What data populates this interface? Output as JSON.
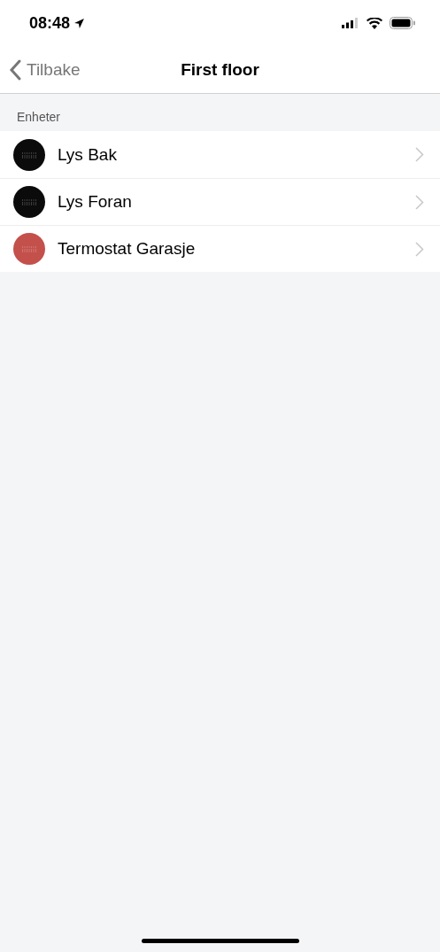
{
  "status_bar": {
    "time": "08:48"
  },
  "nav": {
    "back": "Tilbake",
    "title": "First floor"
  },
  "section": {
    "title": "Enheter"
  },
  "devices": [
    {
      "name": "Lys Bak",
      "color": "#0b0b0b"
    },
    {
      "name": "Lys Foran",
      "color": "#0b0b0b"
    },
    {
      "name": "Termostat Garasje",
      "color": "#c4504b"
    }
  ]
}
